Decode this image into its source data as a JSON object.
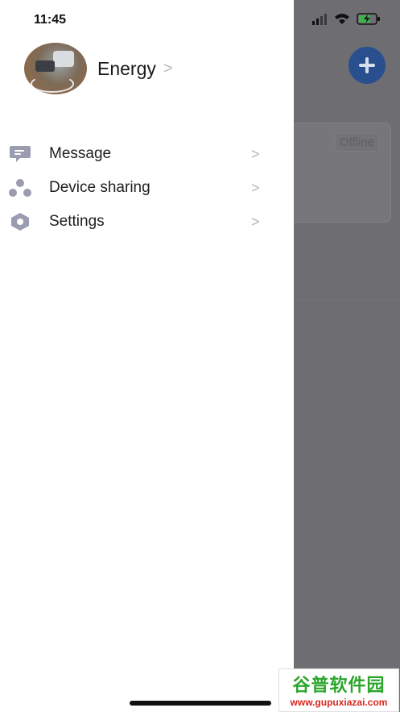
{
  "status_bar": {
    "time": "11:45"
  },
  "background": {
    "card_status": "Offline",
    "add_icon": "plus-icon"
  },
  "drawer": {
    "profile": {
      "name": "Energy",
      "chevron_icon": "chevron-right-icon"
    },
    "menu": [
      {
        "label": "Message",
        "icon": "message-icon"
      },
      {
        "label": "Device sharing",
        "icon": "device-sharing-icon"
      },
      {
        "label": "Settings",
        "icon": "settings-icon"
      }
    ]
  },
  "watermark": {
    "line1": "谷普软件园",
    "line2": "www.gupuxiazai.com"
  },
  "colors": {
    "accent": "#2a4f8e",
    "icon_gray": "#9a9cb0",
    "overlay": "#6e6e72"
  }
}
